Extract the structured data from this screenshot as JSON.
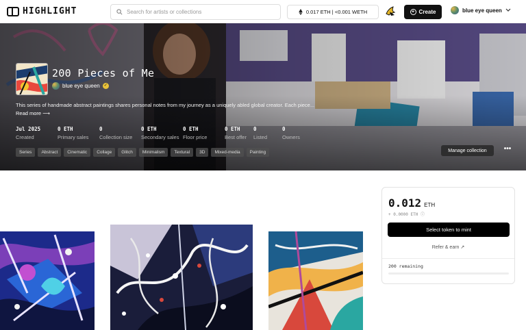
{
  "header": {
    "logo_text": "HIGHLIGHT",
    "search_placeholder": "Search for artists or collections",
    "wallet_balance": "0.017 ETH | <0.001 WETH",
    "create_label": "Create",
    "user_name": "blue eye queen"
  },
  "collection": {
    "title": "200 Pieces of Me",
    "creator": "blue eye queen",
    "description": "This series of handmade abstract paintings shares personal notes from my journey as a uniquely abled global creator. Each piece...",
    "read_more": "Read more ⟶",
    "stats": [
      {
        "value": "Jul 2025",
        "label": "Created"
      },
      {
        "value": "0 ETH",
        "label": "Primary sales"
      },
      {
        "value": "0",
        "label": "Collection size"
      },
      {
        "value": "0 ETH",
        "label": "Secondary sales"
      },
      {
        "value": "0 ETH",
        "label": "Floor price"
      },
      {
        "value": "0 ETH",
        "label": "Best offer"
      },
      {
        "value": "0",
        "label": "Listed"
      },
      {
        "value": "0",
        "label": "Owners"
      }
    ],
    "tags": [
      "Series",
      "Abstract",
      "Cinematic",
      "Collage",
      "Glitch",
      "Minimalism",
      "Textural",
      "3D",
      "Mixed-media",
      "Painting"
    ],
    "manage_label": "Manage collection",
    "more_label": "•••"
  },
  "mint": {
    "price": "0.012",
    "price_unit": "ETH",
    "fee": "+ 0.0000 ETH ⓘ",
    "button_label": "Select token to mint",
    "refer_label": "Refer & earn ↗",
    "remaining": "200 remaining",
    "progress_fraction": 0
  }
}
